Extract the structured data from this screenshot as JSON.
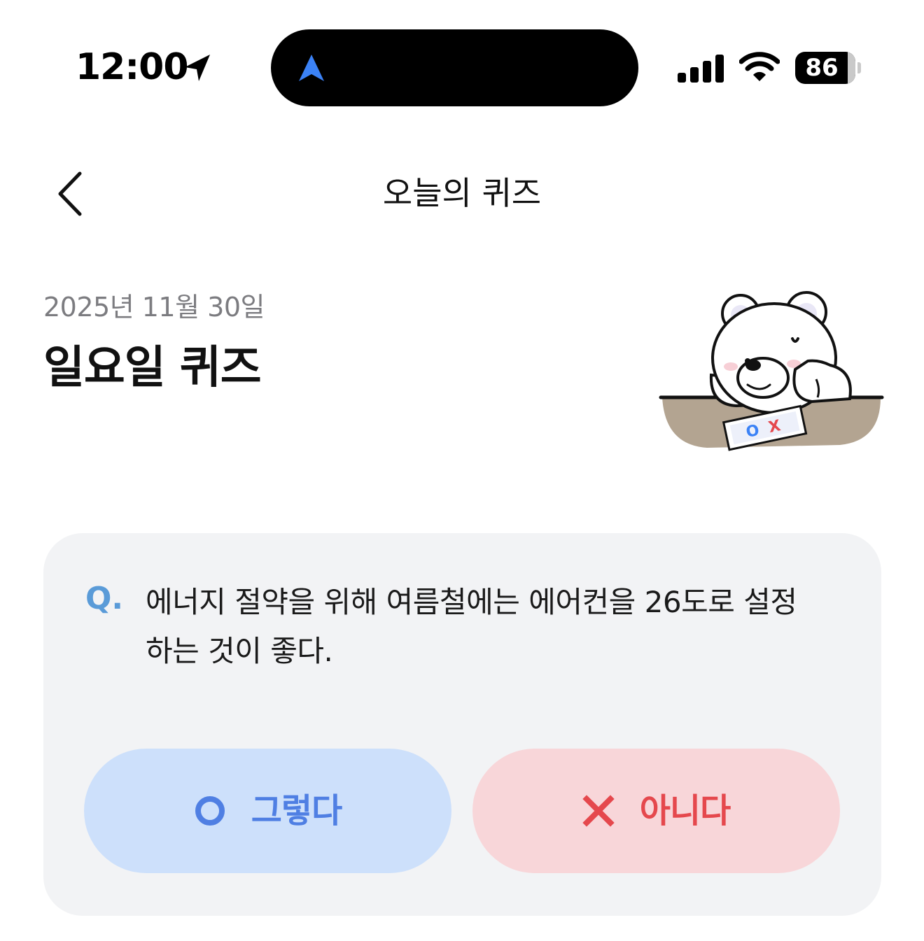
{
  "status_bar": {
    "time": "12:00",
    "battery": "86",
    "icons": [
      "location-arrow-icon",
      "navigation-icon",
      "signal-icon",
      "wifi-icon",
      "battery-icon"
    ]
  },
  "header": {
    "title": "오늘의 퀴즈",
    "back_icon": "chevron-left-icon"
  },
  "hero": {
    "date": "2025년 11월 30일",
    "heading": "일요일 퀴즈",
    "illustration": "bear-with-ox-quiz-paper",
    "illustration_text": "OX"
  },
  "quiz": {
    "q_label": "Q.",
    "question": "에너지 절약을 위해 여름철에는 에어컨을 26도로 설정하는 것이 좋다.",
    "answers": [
      {
        "label": "그렇다",
        "icon": "circle-o-icon",
        "color": "#4f7fe3",
        "bg": "#cde0fb"
      },
      {
        "label": "아니다",
        "icon": "x-mark-icon",
        "color": "#e5484d",
        "bg": "#f8d6d9"
      }
    ]
  }
}
